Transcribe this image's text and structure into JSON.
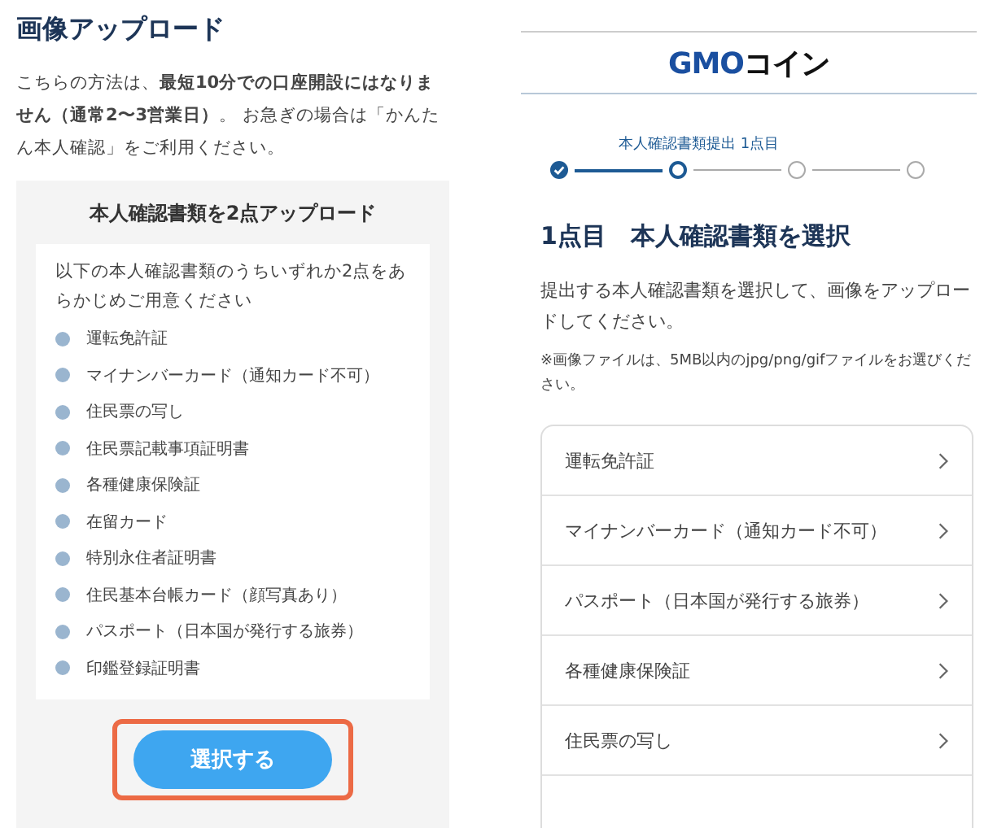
{
  "left": {
    "title": "画像アップロード",
    "intro": "こちらの方法は、**最短10分での口座開設にはなりません（通常2〜3営業日）**。 お急ぎの場合は「かんたん本人確認」をご利用ください。",
    "box_heading": "本人確認書類を2点アップロード",
    "box_intro": "以下の本人確認書類のうちいずれか2点をあらかじめご用意ください",
    "documents": [
      "運転免許証",
      "マイナンバーカード（通知カード不可）",
      "住民票の写し",
      "住民票記載事項証明書",
      "各種健康保険証",
      "在留カード",
      "特別永住者証明書",
      "住民基本台帳カード（顔写真あり）",
      "パスポート（日本国が発行する旅券）",
      "印鑑登録証明書"
    ],
    "button": {
      "label": "選択する",
      "highlighted": true
    }
  },
  "right": {
    "logo": [
      {
        "text": "GMO",
        "color": "#1a4fa0"
      },
      {
        "text": "コイン",
        "color": "#111111"
      }
    ],
    "stepper": {
      "label": "本人確認書類提出 1点目",
      "steps": [
        {
          "kind": "done"
        },
        {
          "kind": "current"
        },
        {
          "kind": "pending"
        },
        {
          "kind": "pending"
        }
      ]
    },
    "heading": "1点目　本人確認書類を選択",
    "description": "提出する本人確認書類を選択して、画像をアップロードしてください。",
    "note": "※画像ファイルは、5MB以内のjpg/png/gifファイルをお選びください。",
    "options": [
      "運転免許証",
      "マイナンバーカード（通知カード不可）",
      "パスポート（日本国が発行する旅券）",
      "各種健康保険証",
      "住民票の写し"
    ]
  }
}
